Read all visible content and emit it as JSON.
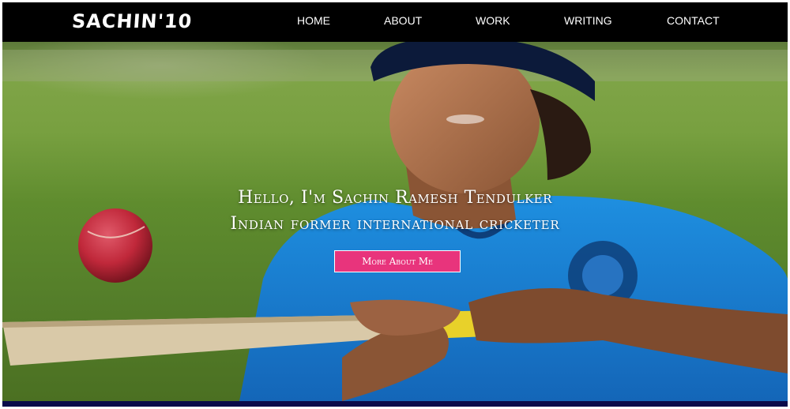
{
  "header": {
    "logo": "SACHIN'10",
    "nav": [
      "HOME",
      "ABOUT",
      "WORK",
      "WRITING",
      "CONTACT"
    ]
  },
  "hero": {
    "headline_line1": "Hello, I'm Sachin Ramesh Tendulker",
    "headline_line2": "Indian former international cricketer",
    "cta_label": "More About Me",
    "background_image": "cricketer-holding-bat-with-ball-photo"
  },
  "colors": {
    "navbar": "#000000",
    "cta": "#e8347c",
    "bottom_strip": "#0a0a4a"
  }
}
